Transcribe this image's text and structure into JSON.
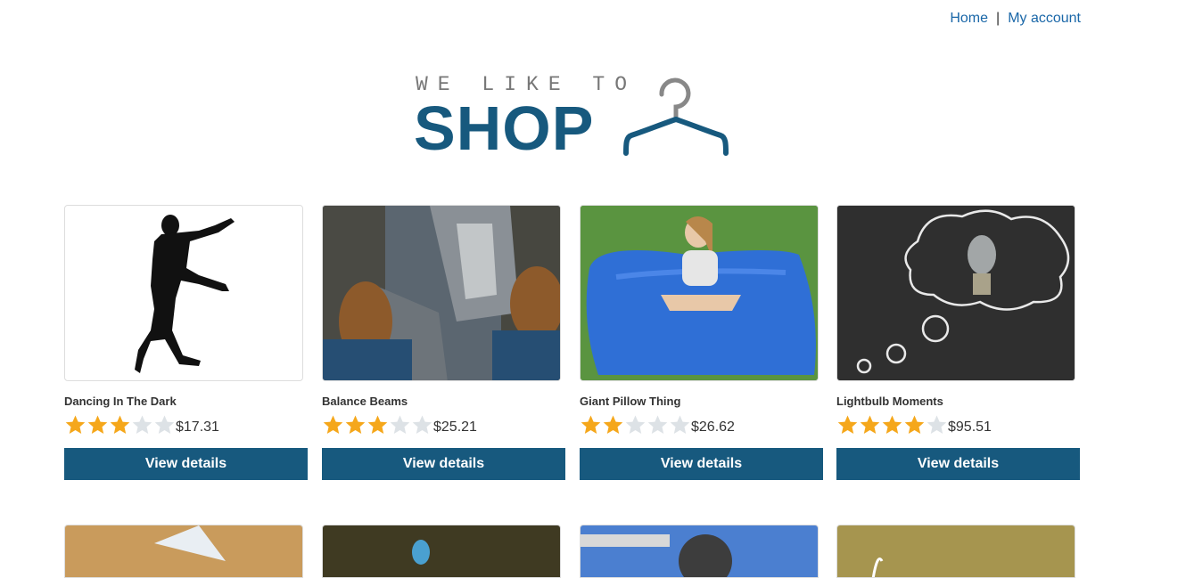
{
  "nav": {
    "home": "Home",
    "separator": "|",
    "account": "My account"
  },
  "logo": {
    "tagline": "WE LIKE TO",
    "word": "SHOP",
    "icon": "hanger-icon"
  },
  "products": [
    {
      "name": "Dancing In The Dark",
      "rating": 3,
      "price": "$17.31",
      "button": "View details"
    },
    {
      "name": "Balance Beams",
      "rating": 3,
      "price": "$25.21",
      "button": "View details"
    },
    {
      "name": "Giant Pillow Thing",
      "rating": 2,
      "price": "$26.62",
      "button": "View details"
    },
    {
      "name": "Lightbulb Moments",
      "rating": 4,
      "price": "$95.51",
      "button": "View details"
    }
  ],
  "colors": {
    "brand": "#17597e",
    "link": "#1a67a8",
    "star_on": "#f5a71b",
    "star_off": "#dde2e6"
  }
}
